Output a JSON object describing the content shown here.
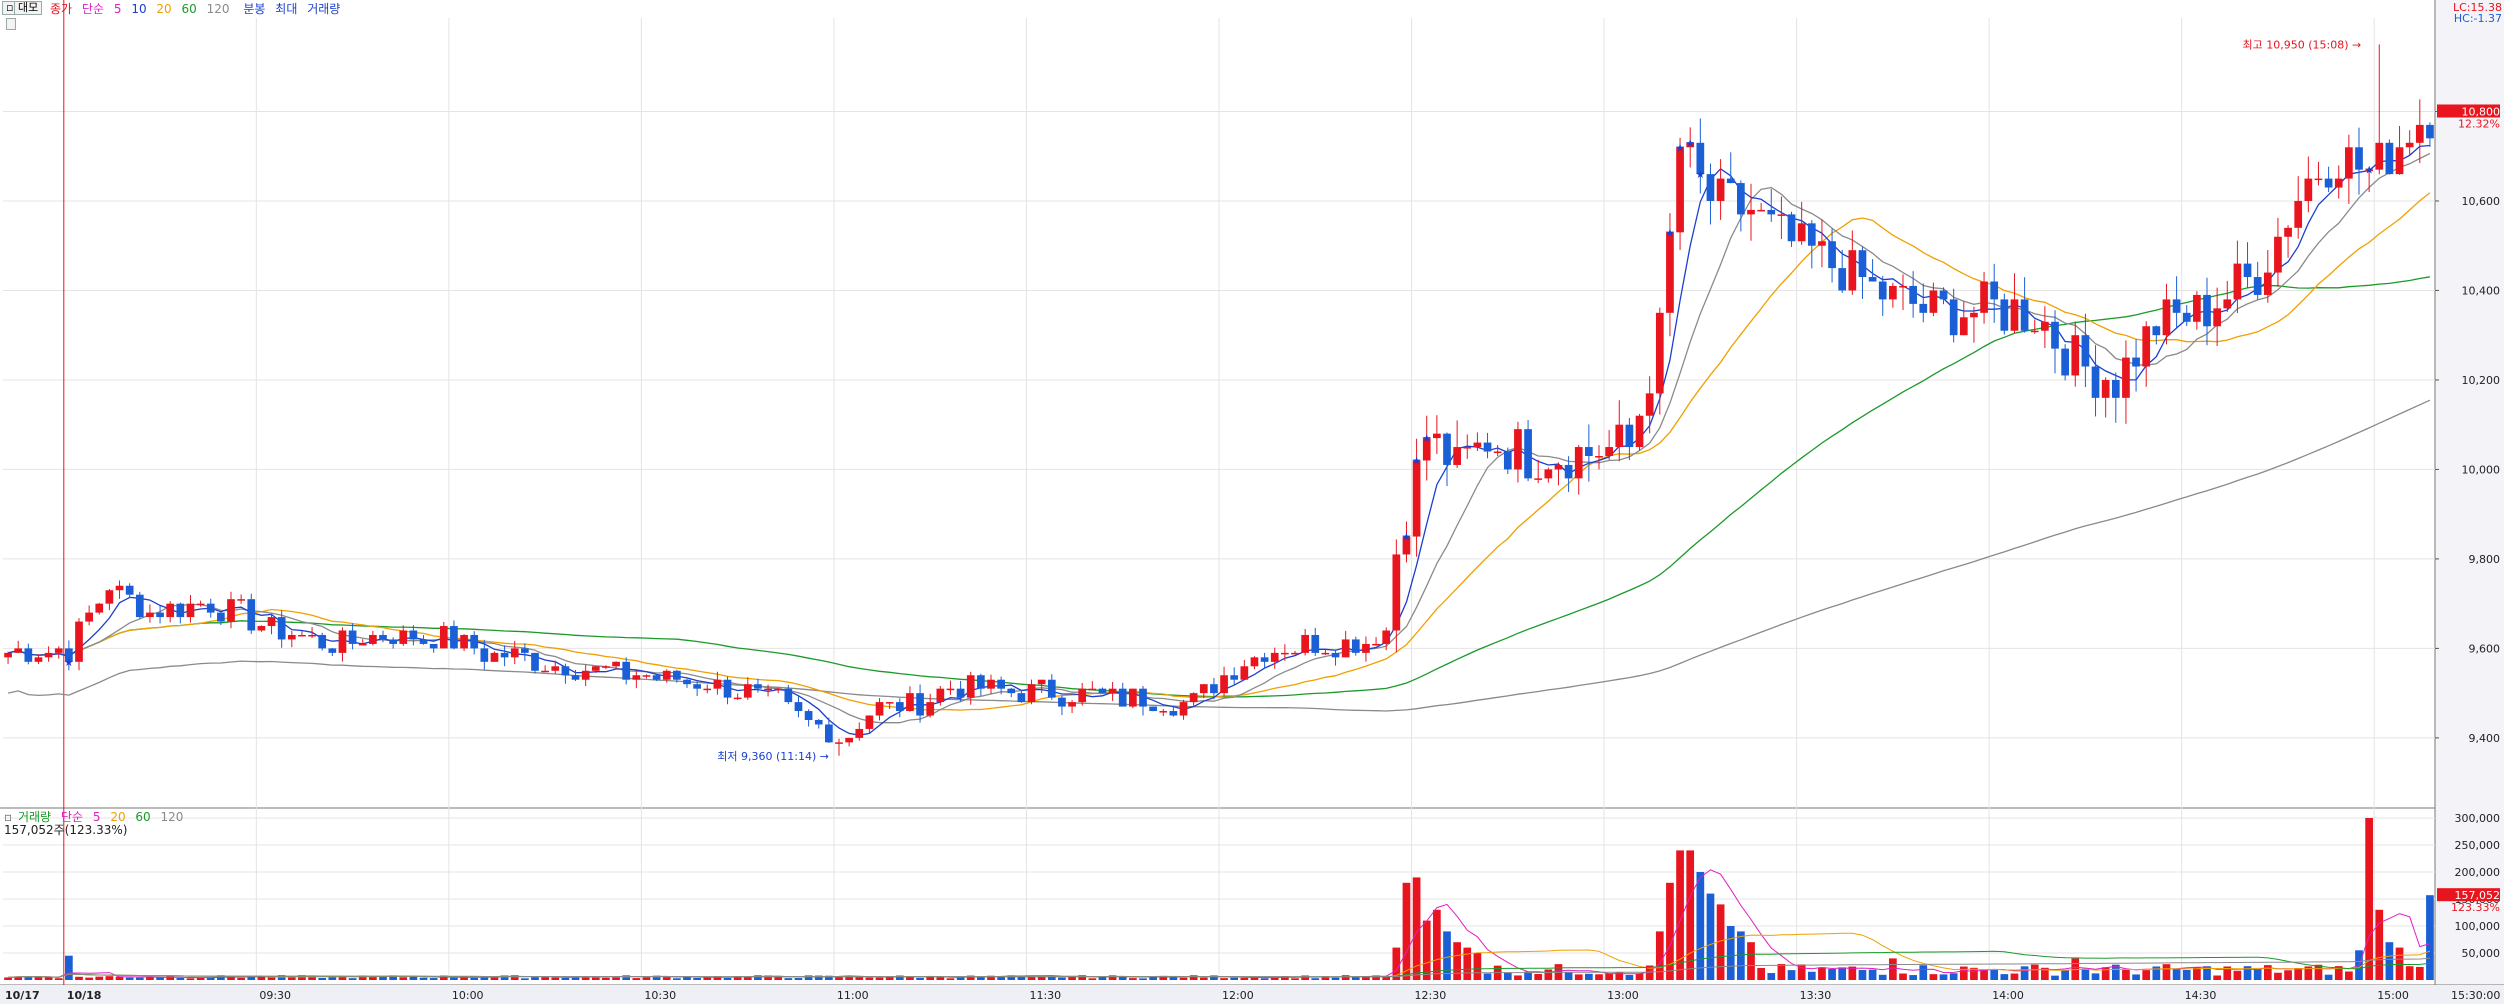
{
  "header": {
    "toggle": "▫",
    "tab_label": "대모",
    "price_legend": [
      "종가",
      "단순",
      "5",
      "10",
      "20",
      "60",
      "120"
    ],
    "style_legend": [
      "분봉",
      "최대",
      "거래량"
    ],
    "lc": "LC:15.38",
    "hc": "HC:-1.37"
  },
  "volume_header": {
    "legend": [
      "거래량",
      "단순",
      "5",
      "20",
      "60",
      "120"
    ],
    "current": "157,052주(123.33%)"
  },
  "colors": {
    "up": "#e8141e",
    "down": "#1a5fd6",
    "ma5": "#1a3fd0",
    "ma10": "#8a8a8a",
    "ma20": "#f0a000",
    "ma60": "#1a9a2a",
    "ma120": "#8a8a8a",
    "vol_ma5": "#e020c0",
    "vol_ma20": "#f0a000",
    "vol_ma60": "#1a9a2a",
    "vol_ma120": "#8a8a8a"
  },
  "chart_data": {
    "type": "candlestick",
    "x_ticks": [
      "10/17",
      "10/18",
      "09:30",
      "10:00",
      "10:30",
      "11:00",
      "11:30",
      "12:00",
      "12:30",
      "13:00",
      "13:30",
      "14:00",
      "14:30",
      "15:00",
      "15:30:00"
    ],
    "y_ticks": [
      "9,400",
      "9,600",
      "9,800",
      "10,000",
      "10,200",
      "10,400",
      "10,600",
      "10,800"
    ],
    "ylim": [
      9250,
      11000
    ],
    "volume_ticks": [
      "50,000",
      "100,000",
      "150,000",
      "200,000",
      "250,000",
      "300,000"
    ],
    "volume_ylim": [
      0,
      300000
    ],
    "annotations": {
      "high": "최고 10,950 (15:08)",
      "low": "최저 9,360 (11:14)",
      "high_price": 10950,
      "low_price": 9360
    },
    "current_price": {
      "label": "10,800",
      "pct": "12.32%",
      "value": 10800
    },
    "current_volume": {
      "label": "157,052",
      "pct": "123.33%",
      "value": 157052
    },
    "anchors": [
      [
        0,
        9590
      ],
      [
        6,
        9600
      ],
      [
        10,
        9740
      ],
      [
        14,
        9680
      ],
      [
        19,
        9700
      ],
      [
        23,
        9680
      ],
      [
        26,
        9640
      ],
      [
        32,
        9610
      ],
      [
        37,
        9630
      ],
      [
        43,
        9620
      ],
      [
        47,
        9590
      ],
      [
        51,
        9580
      ],
      [
        55,
        9560
      ],
      [
        62,
        9540
      ],
      [
        70,
        9520
      ],
      [
        76,
        9480
      ],
      [
        79,
        9430
      ],
      [
        83,
        9410
      ],
      [
        85,
        9460
      ],
      [
        90,
        9480
      ],
      [
        93,
        9510
      ],
      [
        97,
        9510
      ],
      [
        103,
        9500
      ],
      [
        110,
        9490
      ],
      [
        117,
        9480
      ],
      [
        120,
        9540
      ],
      [
        124,
        9600
      ],
      [
        129,
        9610
      ],
      [
        133,
        9610
      ],
      [
        136,
        9640
      ],
      [
        137,
        9820
      ],
      [
        140,
        10080
      ],
      [
        143,
        10000
      ],
      [
        146,
        10070
      ],
      [
        150,
        10030
      ],
      [
        155,
        10040
      ],
      [
        160,
        10050
      ],
      [
        163,
        10300
      ],
      [
        165,
        10720
      ],
      [
        168,
        10600
      ],
      [
        172,
        10580
      ],
      [
        176,
        10500
      ],
      [
        180,
        10460
      ],
      [
        186,
        10380
      ],
      [
        190,
        10350
      ],
      [
        195,
        10360
      ],
      [
        200,
        10350
      ],
      [
        204,
        10240
      ],
      [
        208,
        10200
      ],
      [
        212,
        10320
      ],
      [
        217,
        10360
      ],
      [
        222,
        10440
      ],
      [
        227,
        10650
      ],
      [
        230,
        10700
      ],
      [
        233,
        10660
      ],
      [
        237,
        10760
      ],
      [
        239,
        10800
      ]
    ],
    "intraday_start_index": 6,
    "volume_spikes": [
      [
        6,
        45000
      ],
      [
        137,
        60000
      ],
      [
        138,
        180000
      ],
      [
        139,
        190000
      ],
      [
        140,
        110000
      ],
      [
        141,
        130000
      ],
      [
        142,
        90000
      ],
      [
        143,
        70000
      ],
      [
        144,
        60000
      ],
      [
        145,
        50000
      ],
      [
        163,
        90000
      ],
      [
        164,
        180000
      ],
      [
        165,
        240000
      ],
      [
        166,
        240000
      ],
      [
        167,
        200000
      ],
      [
        168,
        160000
      ],
      [
        169,
        140000
      ],
      [
        170,
        100000
      ],
      [
        171,
        90000
      ],
      [
        172,
        70000
      ],
      [
        186,
        40000
      ],
      [
        204,
        40000
      ],
      [
        232,
        55000
      ],
      [
        233,
        300000
      ],
      [
        234,
        130000
      ],
      [
        235,
        70000
      ],
      [
        236,
        60000
      ],
      [
        239,
        157052
      ]
    ]
  }
}
